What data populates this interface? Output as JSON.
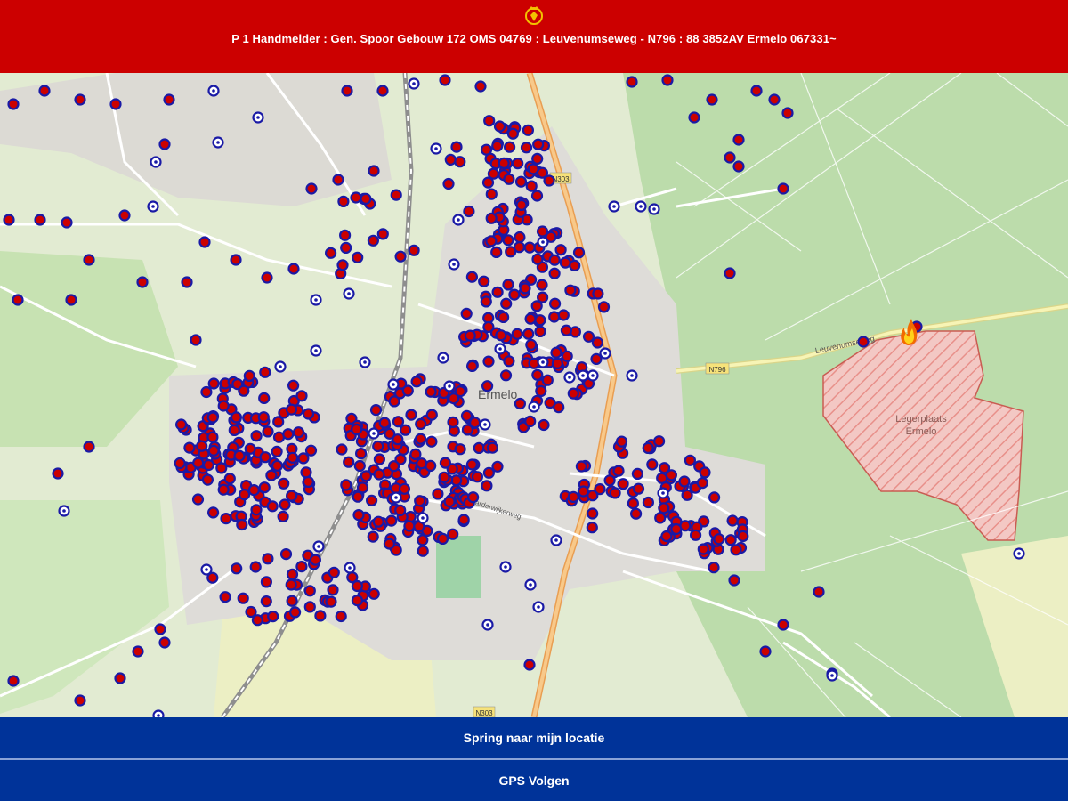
{
  "header": {
    "logo_icon": "fire-department-crest-icon",
    "title": "P 1 Handmelder : Gen. Spoor Gebouw 172 OMS 04769 : Leuvenumseweg - N796 : 88 3852AV Ermelo 067331~",
    "background": "#cc0000"
  },
  "map": {
    "labels": {
      "town": "Ermelo",
      "training_area_line1": "Legerplaats",
      "training_area_line2": "Ermelo",
      "road_main": "N303",
      "road_east": "N796",
      "road_east_name": "Leuvenumseweg",
      "road_south": "N303",
      "road_harderwijk": "Harderwijkerweg"
    },
    "incident_icon": "fire-icon",
    "hydrant_marker_color": "#cc0000",
    "hydrant_ring_color": "#1a1aa6",
    "water_marker_icon": "star-marker-icon"
  },
  "buttons": {
    "locate": "Spring naar mijn locatie",
    "gps": "GPS Volgen",
    "background": "#003399"
  }
}
